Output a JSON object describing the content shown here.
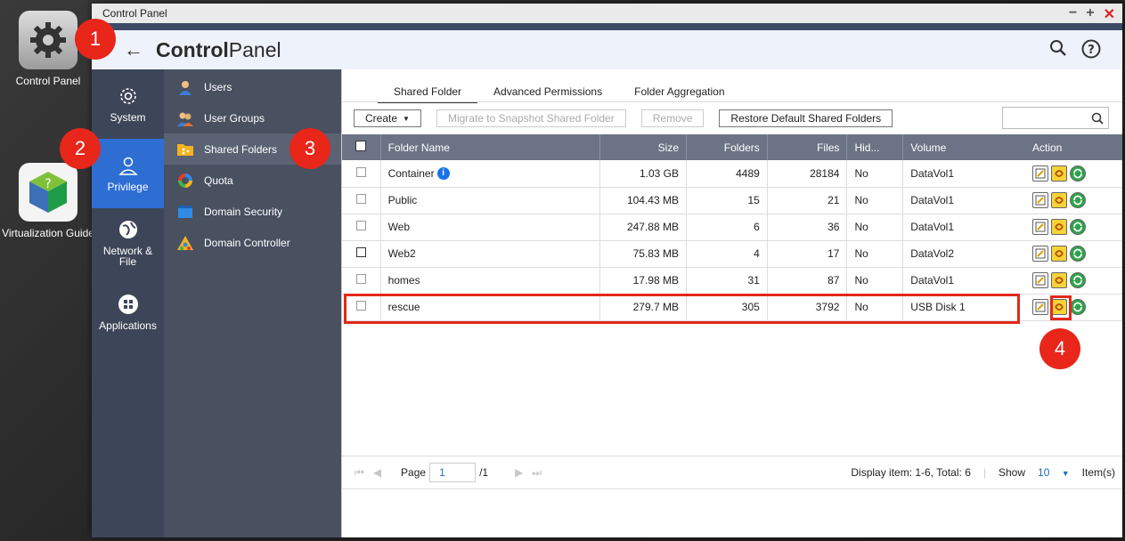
{
  "desktop": {
    "icons": [
      {
        "label": "Control Panel"
      },
      {
        "label": "Virtualization Guide"
      }
    ]
  },
  "window": {
    "title": "Control Panel",
    "app_title_bold": "Control",
    "app_title_thin": "Panel"
  },
  "leftnav": [
    {
      "label": "System"
    },
    {
      "label": "Privilege"
    },
    {
      "label": "Network &\nFile"
    },
    {
      "label": "Applications"
    }
  ],
  "subnav": [
    {
      "label": "Users"
    },
    {
      "label": "User Groups"
    },
    {
      "label": "Shared Folders"
    },
    {
      "label": "Quota"
    },
    {
      "label": "Domain Security"
    },
    {
      "label": "Domain Controller"
    }
  ],
  "tabs": [
    {
      "label": "Shared Folder"
    },
    {
      "label": "Advanced Permissions"
    },
    {
      "label": "Folder Aggregation"
    }
  ],
  "toolbar": {
    "create": "Create",
    "migrate": "Migrate to Snapshot Shared Folder",
    "remove": "Remove",
    "restore": "Restore Default Shared Folders"
  },
  "table": {
    "headers": {
      "name": "Folder Name",
      "size": "Size",
      "folders": "Folders",
      "files": "Files",
      "hidden": "Hid...",
      "volume": "Volume",
      "action": "Action"
    },
    "rows": [
      {
        "name": "Container",
        "size": "1.03 GB",
        "folders": "4489",
        "files": "28184",
        "hidden": "No",
        "volume": "DataVol1"
      },
      {
        "name": "Public",
        "size": "104.43 MB",
        "folders": "15",
        "files": "21",
        "hidden": "No",
        "volume": "DataVol1"
      },
      {
        "name": "Web",
        "size": "247.88 MB",
        "folders": "6",
        "files": "36",
        "hidden": "No",
        "volume": "DataVol1"
      },
      {
        "name": "Web2",
        "size": "75.83 MB",
        "folders": "4",
        "files": "17",
        "hidden": "No",
        "volume": "DataVol2"
      },
      {
        "name": "homes",
        "size": "17.98 MB",
        "folders": "31",
        "files": "87",
        "hidden": "No",
        "volume": "DataVol1"
      },
      {
        "name": "rescue",
        "size": "279.7 MB",
        "folders": "305",
        "files": "3792",
        "hidden": "No",
        "volume": "USB Disk 1"
      }
    ]
  },
  "pager": {
    "page_label": "Page",
    "page_value": "1",
    "page_total": "/1",
    "display": "Display item: 1-6, Total: 6",
    "show_label": "Show",
    "show_value": "10",
    "items_label": "Item(s)"
  },
  "badges": [
    "1",
    "2",
    "3",
    "4"
  ],
  "colors": {
    "badge": "#e8261a",
    "accent": "#2e6ed3",
    "nav_bg": "#3d4658"
  }
}
